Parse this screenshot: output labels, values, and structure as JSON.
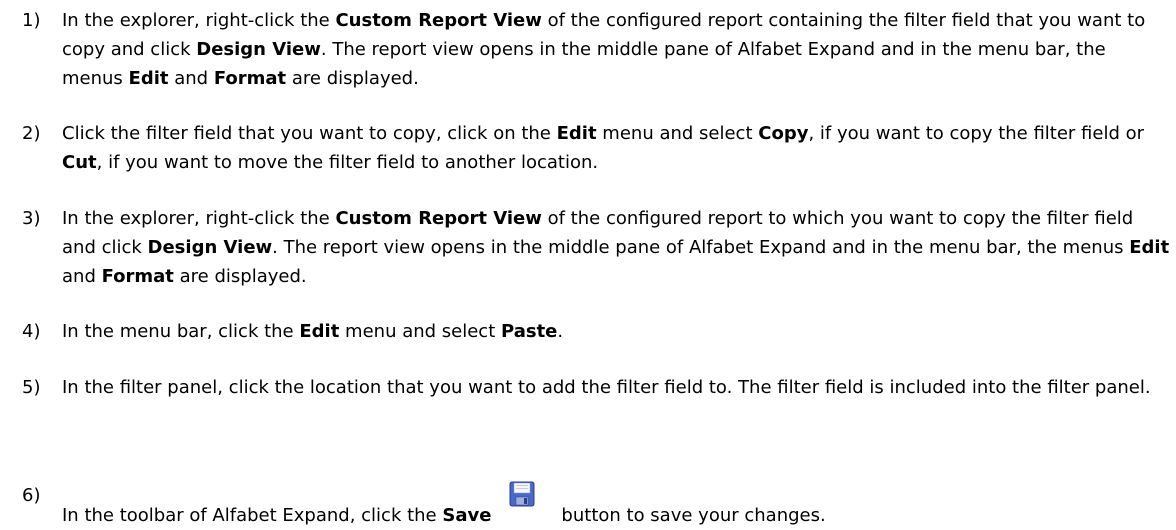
{
  "steps": [
    {
      "num": "1)",
      "parts": [
        "In the explorer, right-click the ",
        "Custom Report View",
        " of the configured report containing the filter field that you want to copy and click ",
        "Design View",
        ". The report view opens in the middle pane of Alfabet Expand and in the menu bar, the menus ",
        "Edit",
        " and ",
        "Format",
        " are displayed."
      ]
    },
    {
      "num": "2)",
      "parts": [
        "Click the filter field that you want to copy, click on the ",
        "Edit",
        " menu and select ",
        "Copy",
        ", if you want to copy the filter field or ",
        "Cut",
        ", if you want to move the filter field to another location."
      ]
    },
    {
      "num": "3)",
      "parts": [
        "In the explorer, right-click the ",
        "Custom Report View",
        " of the configured report to which you want to copy the filter field and click ",
        "Design View",
        ". The report view opens in the middle pane of Alfabet Expand and in the menu bar, the menus ",
        "Edit",
        " and ",
        "Format",
        " are displayed."
      ]
    },
    {
      "num": "4)",
      "parts": [
        "In the menu bar, click the ",
        "Edit",
        " menu and select ",
        "Paste",
        "."
      ]
    },
    {
      "num": "5)",
      "parts": [
        "In the filter panel, click the location that you want to add the filter field to. The filter field is included into the filter panel."
      ]
    },
    {
      "num": "6)",
      "parts": [
        "In the toolbar of Alfabet Expand, click the ",
        "Save",
        "button to save your changes."
      ],
      "icon": "save-icon"
    }
  ]
}
